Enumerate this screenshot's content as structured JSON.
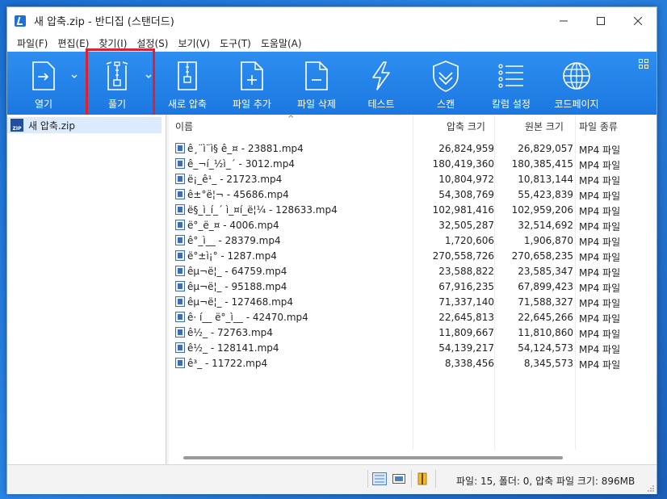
{
  "window": {
    "title": "새 압축.zip - 반디집 (스탠더드)"
  },
  "menu": [
    "파일(F)",
    "편집(E)",
    "찾기(I)",
    "설정(S)",
    "보기(V)",
    "도구(T)",
    "도움말(A)"
  ],
  "toolbar": {
    "open": "열기",
    "extract": "풀기",
    "new_archive": "새로 압축",
    "add_file": "파일 추가",
    "delete_file": "파일 삭제",
    "test": "테스트",
    "scan": "스캔",
    "column_settings": "칼럼 설정",
    "codepage": "코드페이지"
  },
  "tree": {
    "archive_name": "새 압축.zip",
    "zip_badge": "ZIP"
  },
  "columns": {
    "name": "이름",
    "compressed": "압축 크기",
    "original": "원본 크기",
    "type": "파일 종류"
  },
  "files": [
    {
      "name": "ê¸¨ì¨ì§ ê_¤ - 23881.mp4",
      "compressed": "26,824,959",
      "original": "26,829,057",
      "type": "MP4 파일"
    },
    {
      "name": "ê_¬í_½ì_´ - 3012.mp4",
      "compressed": "180,419,360",
      "original": "180,385,415",
      "type": "MP4 파일"
    },
    {
      "name": "ë¡_ê¹_ - 21723.mp4",
      "compressed": "10,804,972",
      "original": "10,813,144",
      "type": "MP4 파일"
    },
    {
      "name": "ê±°ë¦¬ - 45686.mp4",
      "compressed": "54,308,769",
      "original": "55,423,839",
      "type": "MP4 파일"
    },
    {
      "name": "ë§_ì_í_´ ì_¤í_ë¦¼ - 128633.mp4",
      "compressed": "102,981,416",
      "original": "102,959,206",
      "type": "MP4 파일"
    },
    {
      "name": "ë°_ë_¤ - 4006.mp4",
      "compressed": "32,505,287",
      "original": "32,514,692",
      "type": "MP4 파일"
    },
    {
      "name": "ê°_ì__ - 28379.mp4",
      "compressed": "1,720,606",
      "original": "1,906,870",
      "type": "MP4 파일"
    },
    {
      "name": "ë°±ì¡° - 1287.mp4",
      "compressed": "270,558,726",
      "original": "270,658,235",
      "type": "MP4 파일"
    },
    {
      "name": "êµ¬ë¦_ - 64759.mp4",
      "compressed": "23,588,822",
      "original": "23,585,347",
      "type": "MP4 파일"
    },
    {
      "name": "êµ¬ë¦_ - 95188.mp4",
      "compressed": "67,916,235",
      "original": "67,899,423",
      "type": "MP4 파일"
    },
    {
      "name": "êµ¬ë¦_ - 127468.mp4",
      "compressed": "71,337,140",
      "original": "71,588,327",
      "type": "MP4 파일"
    },
    {
      "name": "ê· í__ ë°_ì__ - 42470.mp4",
      "compressed": "22,645,813",
      "original": "22,645,266",
      "type": "MP4 파일"
    },
    {
      "name": "ê½_ - 72763.mp4",
      "compressed": "11,809,667",
      "original": "11,810,860",
      "type": "MP4 파일"
    },
    {
      "name": "ê½_ - 128141.mp4",
      "compressed": "54,139,217",
      "original": "54,124,573",
      "type": "MP4 파일"
    },
    {
      "name": "ê³_ - 11722.mp4",
      "compressed": "8,338,456",
      "original": "8,345,573",
      "type": "MP4 파일"
    }
  ],
  "status": {
    "summary": "파일: 15, 폴더: 0, 압축 파일 크기: 896MB"
  },
  "colors": {
    "toolbar_top": "#2d8ef0",
    "toolbar_bottom": "#1c78e0",
    "highlight": "#e0202a",
    "selection": "#dcebfc"
  }
}
